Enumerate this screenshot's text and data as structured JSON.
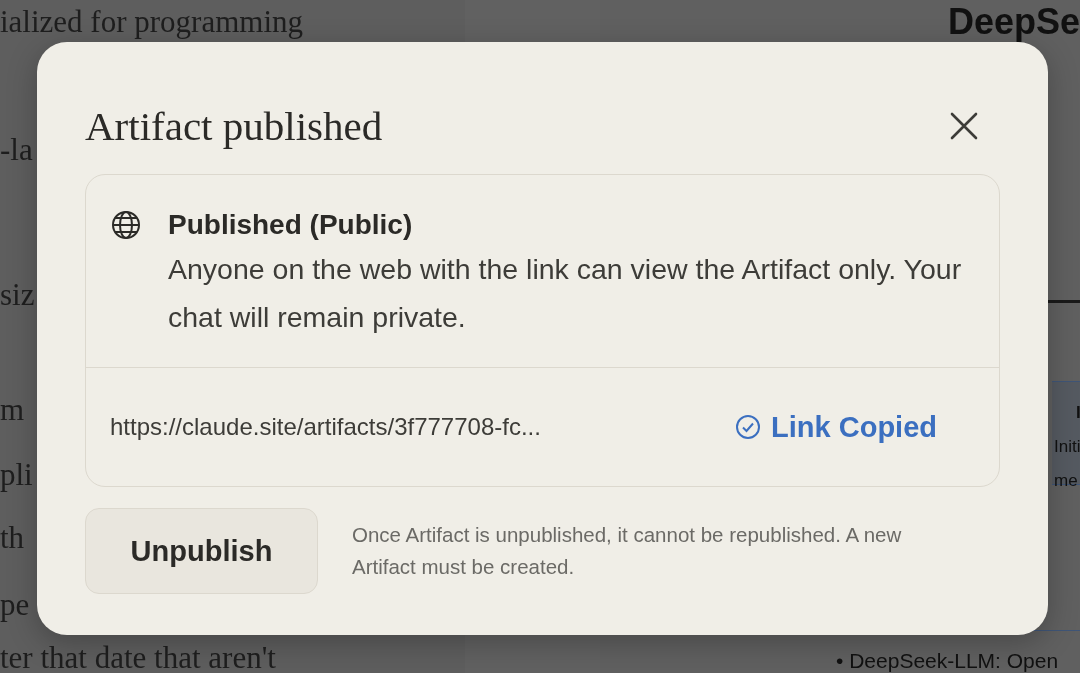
{
  "background": {
    "left_lines": [
      "ialized for programming",
      "-la",
      "siz",
      "m",
      "pli",
      "th",
      "pe",
      "ter that date that aren't"
    ],
    "right": {
      "title": "DeepSe",
      "card_lines": [
        "I",
        "Initi",
        "me"
      ],
      "bullet": "• DeepSeek-LLM: Open"
    }
  },
  "dialog": {
    "title": "Artifact published",
    "status": {
      "heading": "Published (Public)",
      "description": "Anyone on the web with the link can view the Artifact only. Your chat will remain private."
    },
    "link": {
      "url": "https://claude.site/artifacts/3f777708-fc...",
      "copied_label": "Link Copied",
      "copied": true
    },
    "unpublish_button": "Unpublish",
    "note": "Once Artifact is unpublished, it cannot be republished. A new Artifact must be created."
  }
}
